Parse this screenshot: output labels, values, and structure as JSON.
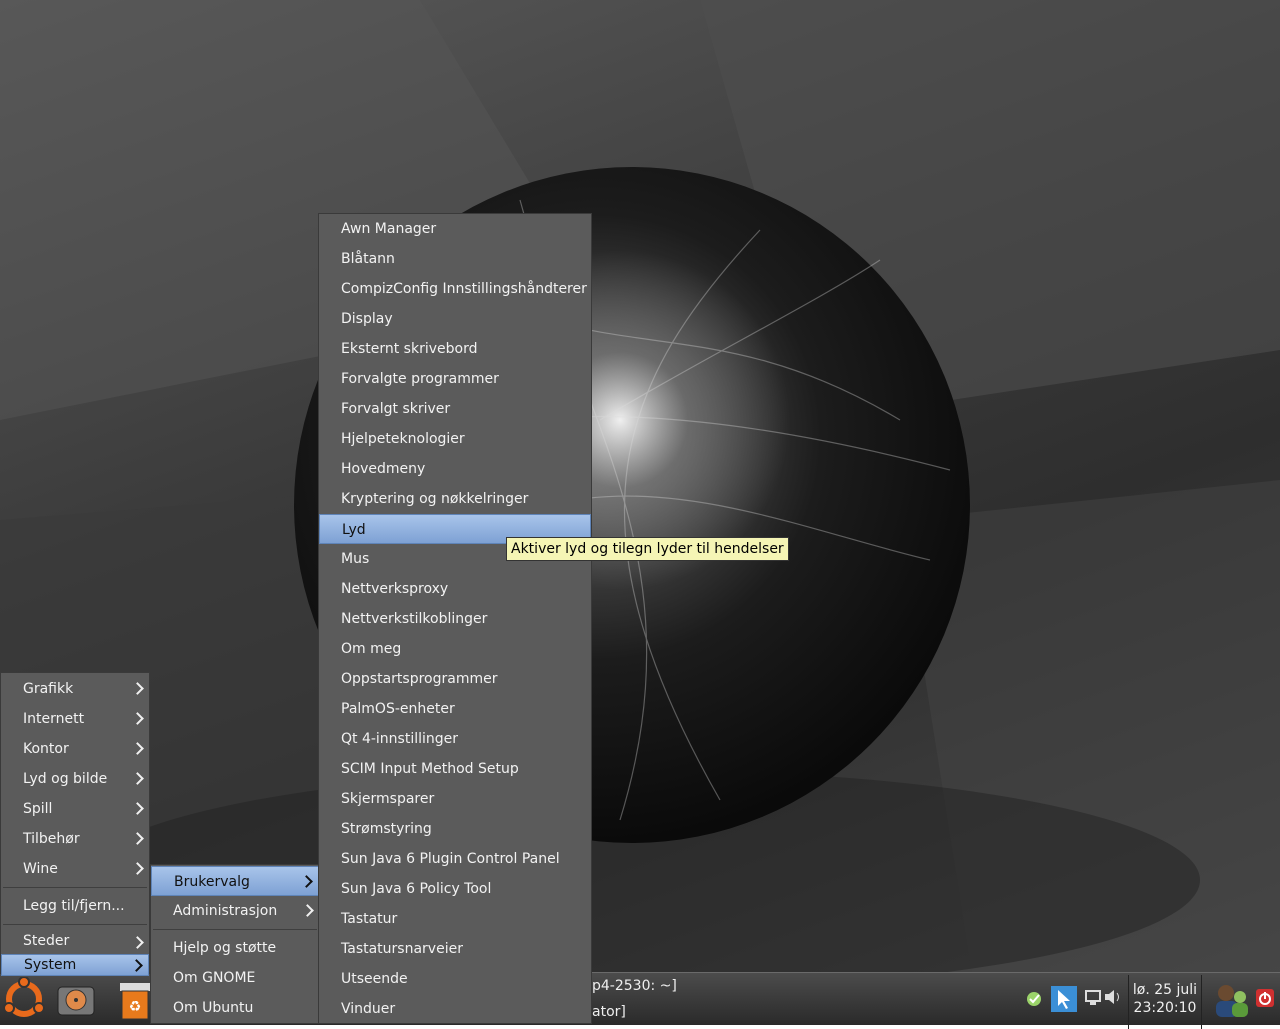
{
  "main_menu": {
    "items": [
      {
        "label": "Grafikk",
        "submenu": true
      },
      {
        "label": "Internett",
        "submenu": true
      },
      {
        "label": "Kontor",
        "submenu": true
      },
      {
        "label": "Lyd og bilde",
        "submenu": true
      },
      {
        "label": "Spill",
        "submenu": true
      },
      {
        "label": "Tilbehør",
        "submenu": true
      },
      {
        "label": "Wine",
        "submenu": true
      }
    ],
    "add_remove": "Legg til/fjern...",
    "places": "Steder",
    "system": "System"
  },
  "system_menu": {
    "preferences": "Brukervalg",
    "administration": "Administrasjon",
    "help": "Hjelp og støtte",
    "about_gnome": "Om GNOME",
    "about_ubuntu": "Om Ubuntu"
  },
  "preferences_menu": {
    "items": [
      "Awn Manager",
      "Blåtann",
      "CompizConfig Innstillingshåndterer",
      "Display",
      "Eksternt skrivebord",
      "Forvalgte programmer",
      "Forvalgt skriver",
      "Hjelpeteknologier",
      "Hovedmeny",
      "Kryptering og nøkkelringer",
      "Lyd",
      "Mus",
      "Nettverksproxy",
      "Nettverkstilkoblinger",
      "Om meg",
      "Oppstartsprogrammer",
      "PalmOS-enheter",
      "Qt 4-innstillinger",
      "SCIM Input Method Setup",
      "Skjermsparer",
      "Strømstyring",
      "Sun Java 6 Plugin Control Panel",
      "Sun Java 6 Policy Tool",
      "Tastatur",
      "Tastatursnarveier",
      "Utseende",
      "Vinduer"
    ],
    "selected_index": 10
  },
  "tooltip": "Aktiver lyd og tilegn lyder til hendelser",
  "panel": {
    "window_list": [
      "p4-2530: ~]",
      "ator]"
    ],
    "clock_date": "lø. 25 juli",
    "clock_time": "23:20:10"
  },
  "colors": {
    "menu_bg": "#5b5b5b",
    "selection": "#7ea1d4",
    "tooltip_bg": "#f5f5b5"
  }
}
